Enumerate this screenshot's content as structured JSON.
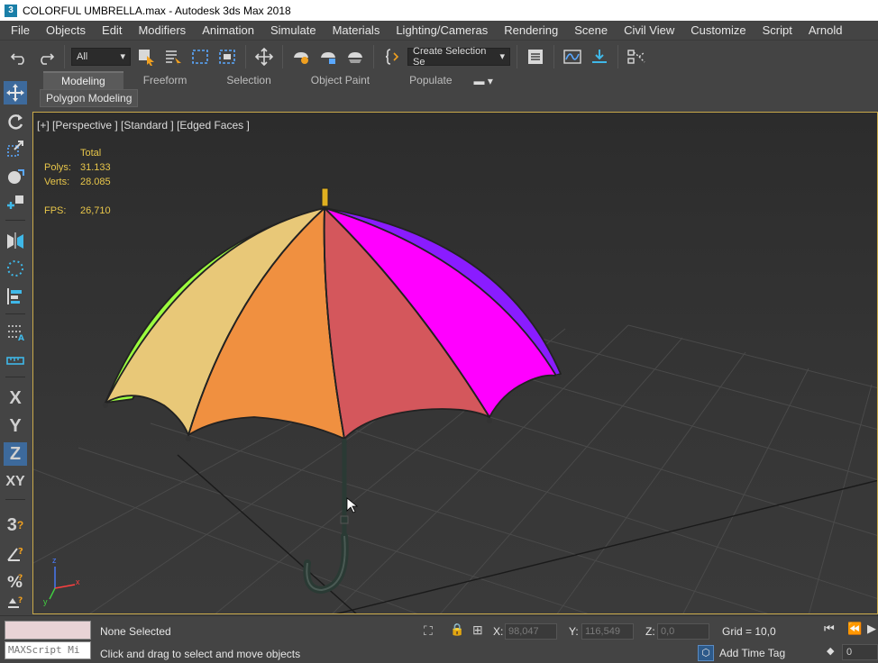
{
  "window": {
    "title": "COLORFUL UMBRELLA.max - Autodesk 3ds Max 2018",
    "app_logo": "3"
  },
  "menu": [
    "File",
    "Objects",
    "Edit",
    "Modifiers",
    "Animation",
    "Simulate",
    "Materials",
    "Lighting/Cameras",
    "Rendering",
    "Scene",
    "Civil View",
    "Customize",
    "Script",
    "Arnold"
  ],
  "toolbar": {
    "selection_filter": "All",
    "named_selection": "Create Selection Se",
    "icons": [
      "undo-icon",
      "redo-icon",
      "select-object-icon",
      "select-by-name-icon",
      "rect-region-icon",
      "window-crossing-icon",
      "move-icon",
      "render-setup-icon",
      "render-frame-icon",
      "render-icon",
      "curly-brace-icon",
      "layer-explorer-icon",
      "curve-editor-icon",
      "import-icon",
      "schematic-icon"
    ]
  },
  "ribbon": {
    "tabs": [
      "Modeling",
      "Freeform",
      "Selection",
      "Object Paint",
      "Populate"
    ],
    "active_tab": "Modeling",
    "panel_label": "Polygon Modeling"
  },
  "left_strip": {
    "axis_x": "X",
    "axis_y": "Y",
    "axis_z": "Z",
    "axis_xy": "XY",
    "snap_label": "3"
  },
  "viewport": {
    "label": "[+] [Perspective ] [Standard ] [Edged Faces ]",
    "stats": {
      "header": "Total",
      "polys_label": "Polys:",
      "polys": "31.133",
      "verts_label": "Verts:",
      "verts": "28.085",
      "fps_label": "FPS:",
      "fps": "26,710"
    },
    "gizmo": {
      "x": "x",
      "y": "y",
      "z": "z"
    },
    "umbrella_panel_colors": [
      "#9cff3e",
      "#e8c878",
      "#f09040",
      "#d4575c",
      "#ff00ff",
      "#8a1cff"
    ]
  },
  "status": {
    "maxscript_placeholder": "MAXScript Mi",
    "selection": "None Selected",
    "prompt": "Click and drag to select and move objects",
    "x_label": "X:",
    "x": "98,047",
    "y_label": "Y:",
    "y": "116,549",
    "z_label": "Z:",
    "z": "0,0",
    "grid": "Grid = 10,0",
    "time_tag": "Add Time Tag",
    "frame": "0"
  }
}
